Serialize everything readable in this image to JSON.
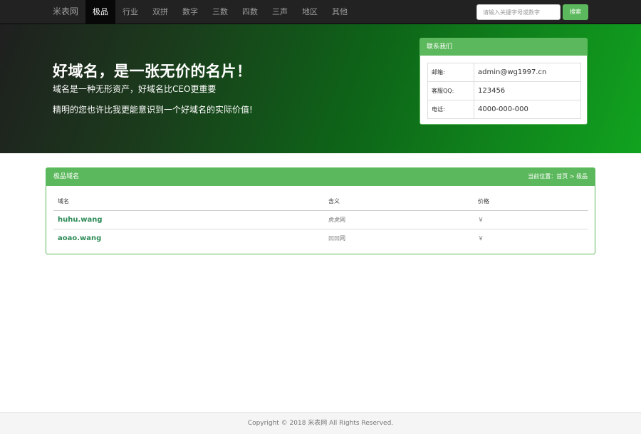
{
  "brand": "米表网",
  "nav": [
    {
      "label": "极品",
      "active": true
    },
    {
      "label": "行业",
      "active": false
    },
    {
      "label": "双拼",
      "active": false
    },
    {
      "label": "数字",
      "active": false
    },
    {
      "label": "三数",
      "active": false
    },
    {
      "label": "四数",
      "active": false
    },
    {
      "label": "三声",
      "active": false
    },
    {
      "label": "地区",
      "active": false
    },
    {
      "label": "其他",
      "active": false
    }
  ],
  "search": {
    "placeholder": "请输入关键字母或数字",
    "button": "搜索"
  },
  "hero": {
    "title": "好域名，是一张无价的名片！",
    "subtitle": "域名是一种无形资产，好域名比CEO更重要",
    "subtitle2": "精明的您也许比我更能意识到一个好域名的实际价值!"
  },
  "contact": {
    "title": "联系我们",
    "rows": [
      {
        "key": "邮箱:",
        "value": "admin@wg1997.cn"
      },
      {
        "key": "客服QQ:",
        "value": "123456"
      },
      {
        "key": "电话:",
        "value": "4000-000-000"
      }
    ]
  },
  "panel": {
    "title": "极品域名",
    "breadcrumb": "当前位置：首页 > 极品",
    "columns": [
      "域名",
      "含义",
      "价格"
    ],
    "rows": [
      {
        "domain": "huhu.wang",
        "meaning": "虎虎网",
        "price": "￥"
      },
      {
        "domain": "aoao.wang",
        "meaning": "凹凹网",
        "price": "￥"
      }
    ]
  },
  "footer": "Copyright © 2018 米表网 All Rights Reserved.",
  "colors": {
    "accent": "#5cb85c",
    "navbar": "#222222",
    "domain_link": "#2e8b57"
  }
}
